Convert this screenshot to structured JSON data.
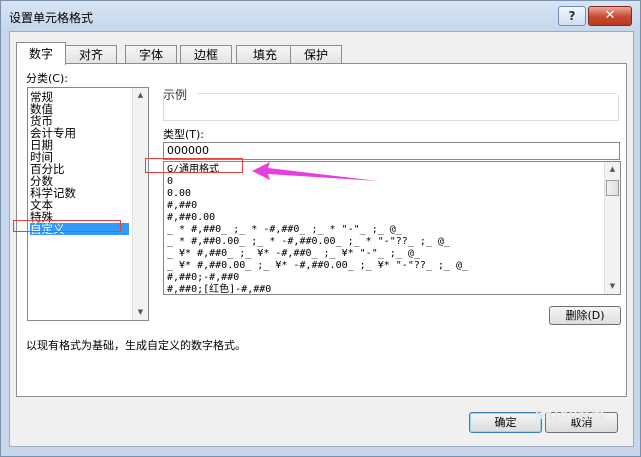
{
  "window": {
    "title": "设置单元格格式",
    "help_label": "?",
    "close_label": "✕"
  },
  "tabs": [
    {
      "label": "数字",
      "active": true
    },
    {
      "label": "对齐",
      "active": false
    },
    {
      "label": "字体",
      "active": false
    },
    {
      "label": "边框",
      "active": false
    },
    {
      "label": "填充",
      "active": false
    },
    {
      "label": "保护",
      "active": false
    }
  ],
  "category": {
    "label": "分类(C):",
    "items": [
      "常规",
      "数值",
      "货币",
      "会计专用",
      "日期",
      "时间",
      "百分比",
      "分数",
      "科学记数",
      "文本",
      "特殊",
      "自定义"
    ],
    "selected": "自定义"
  },
  "sample": {
    "label": "示例",
    "value": ""
  },
  "type": {
    "label": "类型(T):",
    "input_value": "000000",
    "formats": [
      "G/通用格式",
      "0",
      "0.00",
      "#,##0",
      "#,##0.00",
      "_ * #,##0_ ;_ * -#,##0_ ;_ * \"-\"_ ;_ @_",
      "_ * #,##0.00_ ;_ * -#,##0.00_ ;_ * \"-\"??_ ;_ @_",
      "_ ¥* #,##0_ ;_ ¥* -#,##0_ ;_ ¥* \"-\"_ ;_ @_",
      "_ ¥* #,##0.00_ ;_ ¥* -#,##0.00_ ;_ ¥* \"-\"??_ ;_ @_",
      "#,##0;-#,##0",
      "#,##0;[红色]-#,##0"
    ]
  },
  "buttons": {
    "delete": "删除(D)",
    "ok": "确定",
    "cancel": "取消"
  },
  "description": "以现有格式为基础，生成自定义的数字格式。",
  "colors": {
    "annotation_box": "#e8403a",
    "annotation_arrow": "#e83ee0",
    "selection": "#3399ff"
  },
  "watermark": "Baidu经验"
}
